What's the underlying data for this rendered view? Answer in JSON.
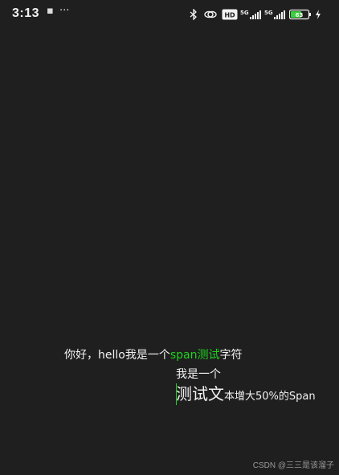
{
  "status_bar": {
    "time": "3:13",
    "notification_glyph": "▪",
    "more_glyph": "···",
    "hd_label": "HD",
    "signal1_label": "5G",
    "signal2_label": "5G",
    "battery_level": "63",
    "battery_level_fraction": 0.63,
    "icons": {
      "bluetooth": "bluetooth-icon",
      "link": "link-icon",
      "hd": "hd-icon",
      "signal1": "signal-icon",
      "signal2": "signal-icon",
      "battery": "battery-icon",
      "charging": "charging-icon"
    },
    "colors": {
      "text": "#f2f2f2",
      "battery": "#3ccf3c"
    }
  },
  "content": {
    "line1": {
      "part1": "你好，hello我是一个",
      "accent": "span测试",
      "part3": "字符"
    },
    "line2": {
      "part1": "我是一个",
      "big": "测试文",
      "rest": "本增大50%的Span"
    },
    "accent_color": "#1fd31f"
  },
  "watermark": "CSDN @三三是该溜子"
}
